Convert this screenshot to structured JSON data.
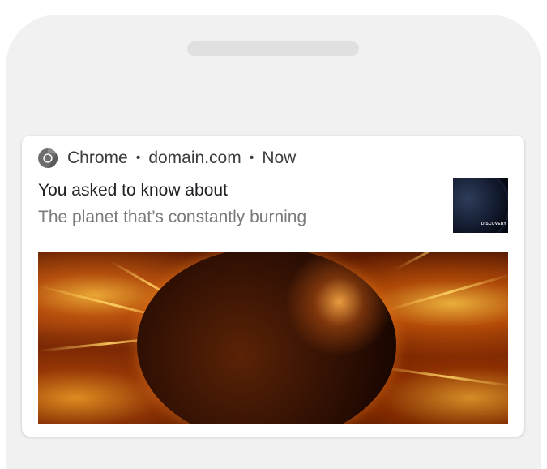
{
  "notification": {
    "app_name": "Chrome",
    "app_icon": "chrome-icon",
    "domain": "domain.com",
    "time": "Now",
    "separator": "•",
    "title": "You asked to know about",
    "body": "The planet that’s constantly burning",
    "thumbnail_label": "DISCOVERY",
    "hero_image": "burning-planet-image"
  },
  "colors": {
    "phone_frame": "#f1f1f1",
    "card_background": "#ffffff",
    "title_text": "#202124",
    "body_text": "#7a7a7a",
    "header_text": "#3c3c3c"
  }
}
